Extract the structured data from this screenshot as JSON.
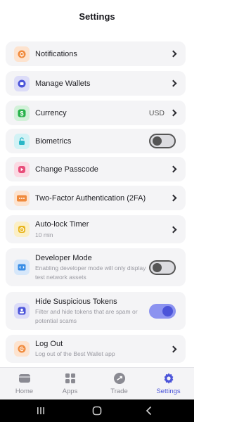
{
  "header": {
    "title": "Settings"
  },
  "rows": [
    {
      "key": "notifications",
      "label": "Notifications",
      "icon": "bell-icon",
      "color": "#f08a3c",
      "bg": "#fde3cf"
    },
    {
      "key": "wallets",
      "label": "Manage Wallets",
      "icon": "wallet-icon",
      "color": "#4b54d9",
      "bg": "#dcdcf8"
    },
    {
      "key": "currency",
      "label": "Currency",
      "value": "USD",
      "icon": "dollar-icon",
      "color": "#27b24a",
      "bg": "#d2f1d9"
    },
    {
      "key": "biometrics",
      "label": "Biometrics",
      "icon": "lock-icon",
      "color": "#29b7c7",
      "bg": "#d2f2f5",
      "toggle": false
    },
    {
      "key": "passcode",
      "label": "Change Passcode",
      "icon": "passcode-icon",
      "color": "#e84d7a",
      "bg": "#fbd9e3"
    },
    {
      "key": "twofa",
      "label": "Two-Factor Authentication (2FA)",
      "icon": "dots-icon",
      "color": "#f08a3c",
      "bg": "#fde3cf"
    },
    {
      "key": "autolock",
      "label": "Auto-lock Timer",
      "sub": "10 min",
      "icon": "timer-icon",
      "color": "#e8b41a",
      "bg": "#fbefc6"
    },
    {
      "key": "devmode",
      "label": "Developer Mode",
      "sub": "Enabling developer mode will only display test network assets",
      "icon": "code-icon",
      "color": "#3a8ee6",
      "bg": "#d6e7fa",
      "toggle": false
    },
    {
      "key": "suspicious",
      "label": "Hide Suspicious Tokens",
      "sub": "Filter and hide tokens that are spam or potential scams",
      "icon": "shield-icon",
      "color": "#4b54d9",
      "bg": "#dcdcf8",
      "toggle": true
    },
    {
      "key": "logout",
      "label": "Log Out",
      "sub": "Log out of the Best Wallet app",
      "icon": "logout-icon",
      "color": "#f08a3c",
      "bg": "#fde3cf"
    }
  ],
  "tabs": [
    {
      "label": "Home",
      "icon": "wallet-card-icon"
    },
    {
      "label": "Apps",
      "icon": "grid-icon"
    },
    {
      "label": "Trade",
      "icon": "trade-icon"
    },
    {
      "label": "Settings",
      "icon": "gear-icon",
      "active": true
    }
  ],
  "accent": "#4b54d9"
}
